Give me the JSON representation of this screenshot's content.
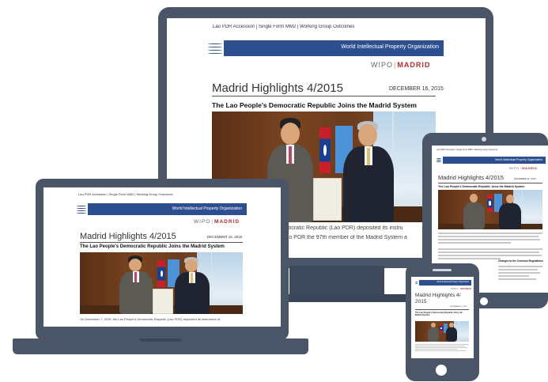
{
  "newsletter": {
    "topbar": "Lao PDR Accession | Single Form MM2 | Working Group Outcomes",
    "org_name": "World Intellectual Property Organization",
    "brand_wipo": "WIPO",
    "brand_separator": "|",
    "brand_madrid": "MADRID",
    "title": "Madrid Highlights 4/2015",
    "date": "DECEMBER 16, 2015",
    "headline": "The Lao People's Democratic Republic Joins the Madrid System",
    "monitor_para_1": "e's Democratic Republic (Lao PDR) deposited its instru",
    "monitor_para_2": "aking Lao PDR the 97th member of the Madrid System a",
    "laptop_para": "On December 7, 2015, the Lao People's Democratic Republic (Lao PDR) deposited its instrument of",
    "tablet_section": "Changes to the Common Regulations"
  },
  "phone": {
    "title_line1": "Madrid Highlights 4/",
    "title_line2": "2015"
  },
  "colors": {
    "device_frame": "#4a5668",
    "banner": "#2e4f8f",
    "madrid_red": "#b22a2a"
  }
}
